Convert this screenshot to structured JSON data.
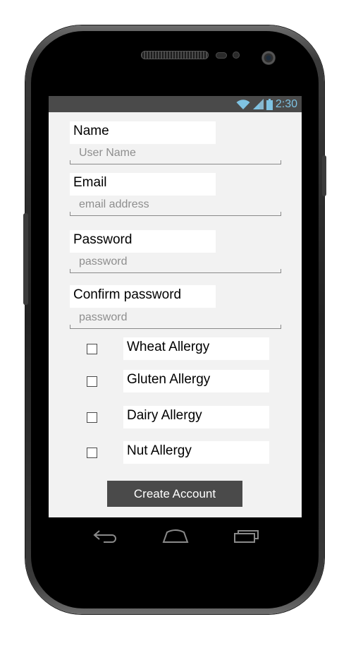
{
  "status_bar": {
    "time": "2:30",
    "time_color": "#7fc3e3"
  },
  "form": {
    "name": {
      "label": "Name",
      "placeholder": "User Name"
    },
    "email": {
      "label": "Email",
      "placeholder": "email address"
    },
    "password": {
      "label": "Password",
      "placeholder": "password"
    },
    "confirm": {
      "label": "Confirm password",
      "placeholder": "password"
    }
  },
  "allergies": [
    {
      "label": "Wheat Allergy",
      "checked": false
    },
    {
      "label": "Gluten Allergy",
      "checked": false
    },
    {
      "label": "Dairy Allergy",
      "checked": false
    },
    {
      "label": "Nut Allergy",
      "checked": false
    }
  ],
  "create_button": {
    "label": "Create Account"
  },
  "nav": {
    "icons": [
      "back-icon",
      "home-icon",
      "recent-apps-icon"
    ]
  },
  "colors": {
    "screen_bg": "#f2f2f2",
    "button_bg": "#4a4a4a",
    "status_bg": "#4a4a4a"
  }
}
